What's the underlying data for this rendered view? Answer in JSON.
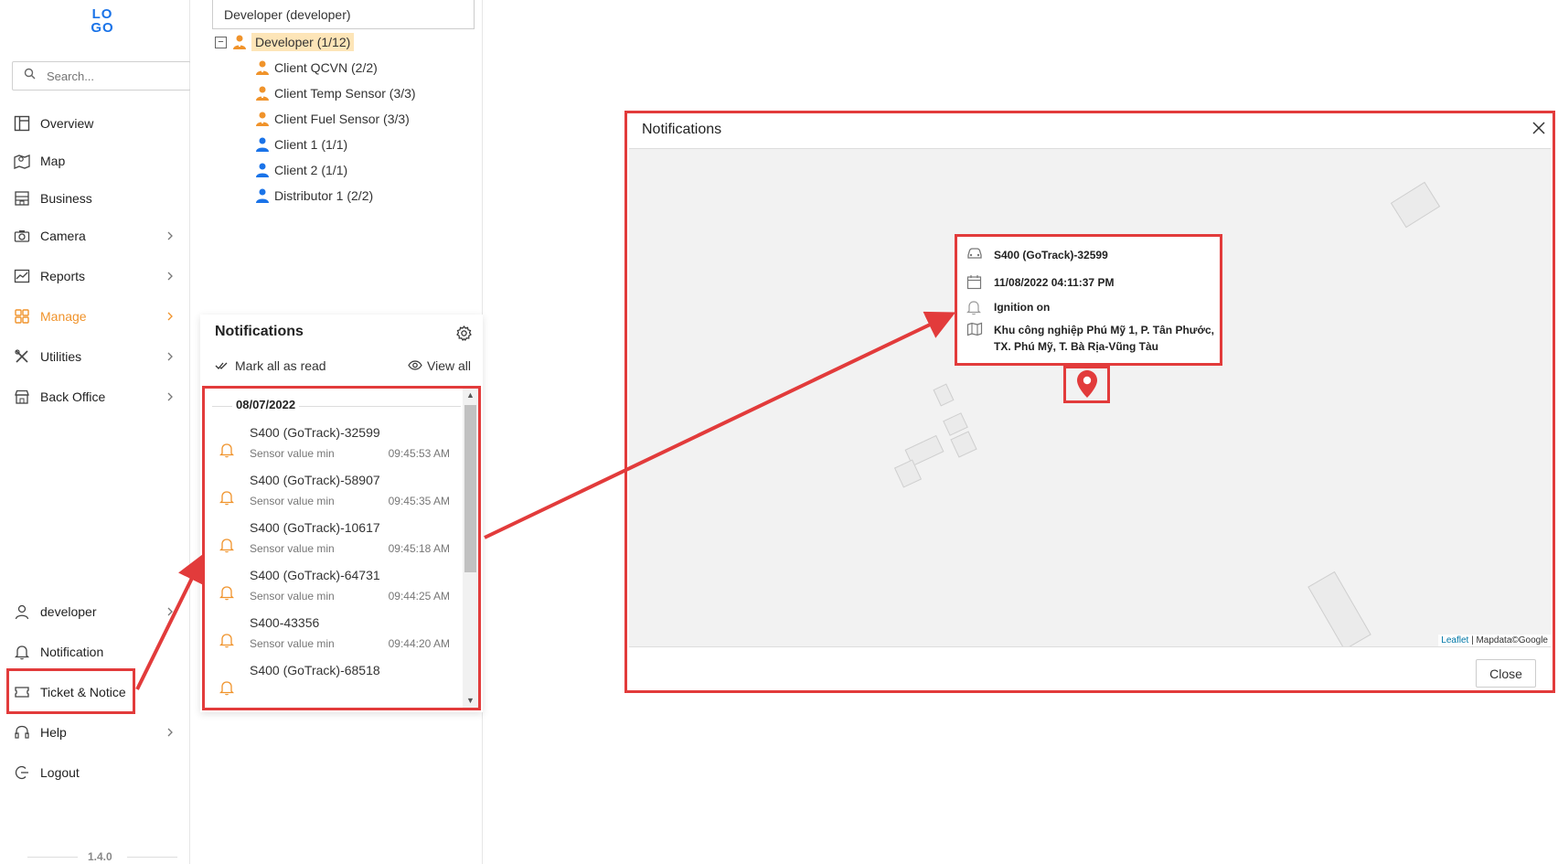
{
  "sidebar": {
    "logo_top": "LO",
    "logo_bottom": "GO",
    "search_placeholder": "Search...",
    "items": [
      {
        "label": "Overview"
      },
      {
        "label": "Map"
      },
      {
        "label": "Business"
      },
      {
        "label": "Camera"
      },
      {
        "label": "Reports"
      },
      {
        "label": "Manage"
      },
      {
        "label": "Utilities"
      },
      {
        "label": "Back Office"
      }
    ],
    "bottom_items": [
      {
        "label": "developer"
      },
      {
        "label": "Notification"
      },
      {
        "label": "Ticket & Notice"
      },
      {
        "label": "Help"
      },
      {
        "label": "Logout"
      }
    ],
    "version": "1.4.0",
    "accent_color": "#f0932b"
  },
  "tree": {
    "header": "Developer (developer)",
    "root": "Developer (1/12)",
    "children": [
      {
        "label": "Client QCVN (2/2)",
        "color": "#f0932b"
      },
      {
        "label": "Client Temp Sensor (3/3)",
        "color": "#f0932b"
      },
      {
        "label": "Client Fuel Sensor (3/3)",
        "color": "#f0932b"
      },
      {
        "label": "Client 1 (1/1)",
        "color": "#1a73e8"
      },
      {
        "label": "Client 2 (1/1)",
        "color": "#1a73e8"
      },
      {
        "label": "Distributor 1 (2/2)",
        "color": "#1a73e8"
      }
    ]
  },
  "notifications": {
    "title": "Notifications",
    "mark_all": "Mark all as read",
    "view_all": "View all",
    "date": "08/07/2022",
    "items": [
      {
        "name": "S400 (GoTrack)-32599",
        "desc": "Sensor value min",
        "time": "09:45:53 AM"
      },
      {
        "name": "S400 (GoTrack)-58907",
        "desc": "Sensor value min",
        "time": "09:45:35 AM"
      },
      {
        "name": "S400 (GoTrack)-10617",
        "desc": "Sensor value min",
        "time": "09:45:18 AM"
      },
      {
        "name": "S400 (GoTrack)-64731",
        "desc": "Sensor value min",
        "time": "09:44:25 AM"
      },
      {
        "name": "S400-43356",
        "desc": "Sensor value min",
        "time": "09:44:20 AM"
      },
      {
        "name": "S400 (GoTrack)-68518",
        "desc": "",
        "time": ""
      }
    ]
  },
  "modal": {
    "title": "Notifications",
    "close_label": "Close",
    "attribution_link": "Leaflet",
    "attribution_text": " | Mapdata©Google",
    "popup": {
      "vehicle": "S400 (GoTrack)-32599",
      "datetime": "11/08/2022 04:11:37 PM",
      "event": "Ignition on",
      "address_line1": "Khu công nghiệp Phú Mỹ 1, P. Tân Phước,",
      "address_line2": "TX. Phú Mỹ, T. Bà Rịa-Vũng Tàu"
    }
  }
}
